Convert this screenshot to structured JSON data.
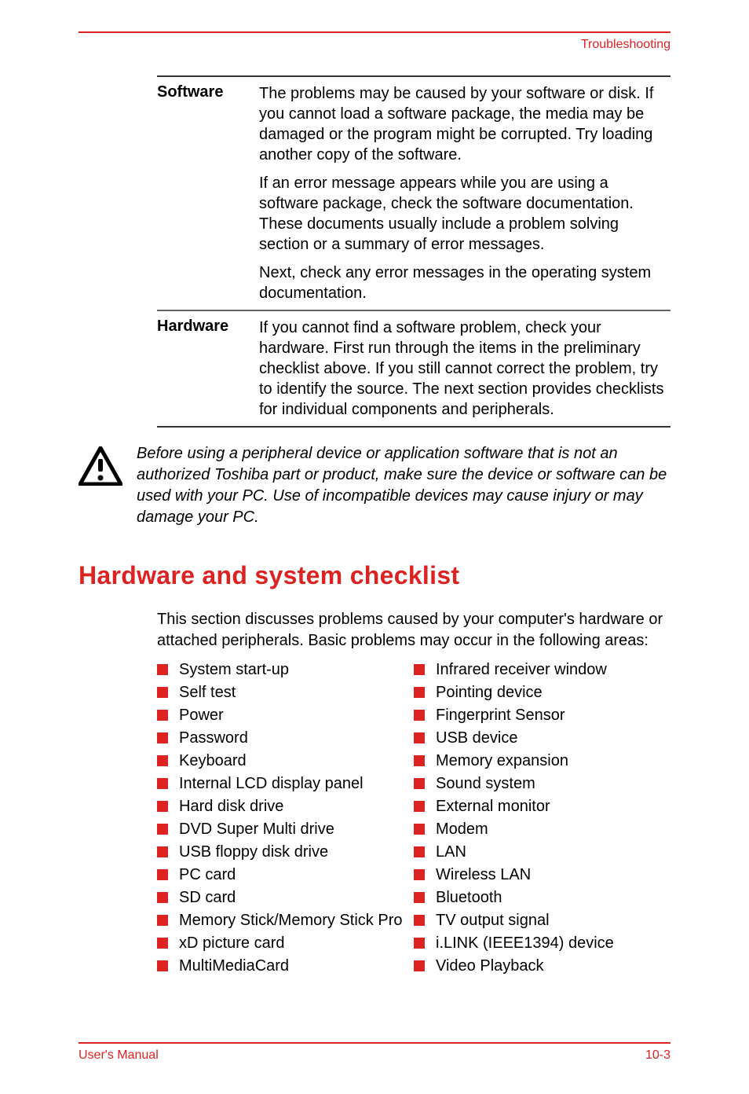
{
  "header": {
    "section_name": "Troubleshooting"
  },
  "definitions": {
    "software": {
      "term": "Software",
      "p1": "The problems may be caused by your software or disk. If you cannot load a software package, the media may be damaged or the program might be corrupted. Try loading another copy of the software.",
      "p2": "If an error message appears while you are using a software package, check the software documentation. These documents usually include a problem solving section or a summary of error messages.",
      "p3": "Next, check any error messages in the operating system documentation."
    },
    "hardware": {
      "term": "Hardware",
      "p1": "If you cannot find a software problem, check your hardware. First run through the items in the preliminary checklist above. If you still cannot correct the problem, try to identify the source. The next section provides checklists for individual components and peripherals."
    }
  },
  "caution": {
    "text": "Before using a peripheral device or application software that is not an authorized Toshiba part or product, make sure the device or software can be used with your PC. Use of incompatible devices may cause injury or may damage your PC."
  },
  "section": {
    "title": "Hardware and system checklist",
    "intro": "This section discusses problems caused by your computer's hardware or attached peripherals. Basic problems may occur in the following areas:"
  },
  "checklist_left": [
    "System start-up",
    "Self test",
    "Power",
    "Password",
    "Keyboard",
    "Internal LCD display panel",
    "Hard disk drive",
    "DVD Super Multi drive",
    "USB floppy disk drive",
    "PC card",
    "SD card",
    "Memory Stick/Memory Stick Pro",
    "xD picture card",
    "MultiMediaCard"
  ],
  "checklist_right": [
    "Infrared receiver window",
    "Pointing device",
    "Fingerprint Sensor",
    "USB device",
    "Memory expansion",
    "Sound system",
    "External monitor",
    "Modem",
    "LAN",
    "Wireless LAN",
    "Bluetooth",
    "TV output signal",
    "i.LINK (IEEE1394) device",
    "Video Playback"
  ],
  "footer": {
    "left": "User's Manual",
    "right": "10-3"
  }
}
